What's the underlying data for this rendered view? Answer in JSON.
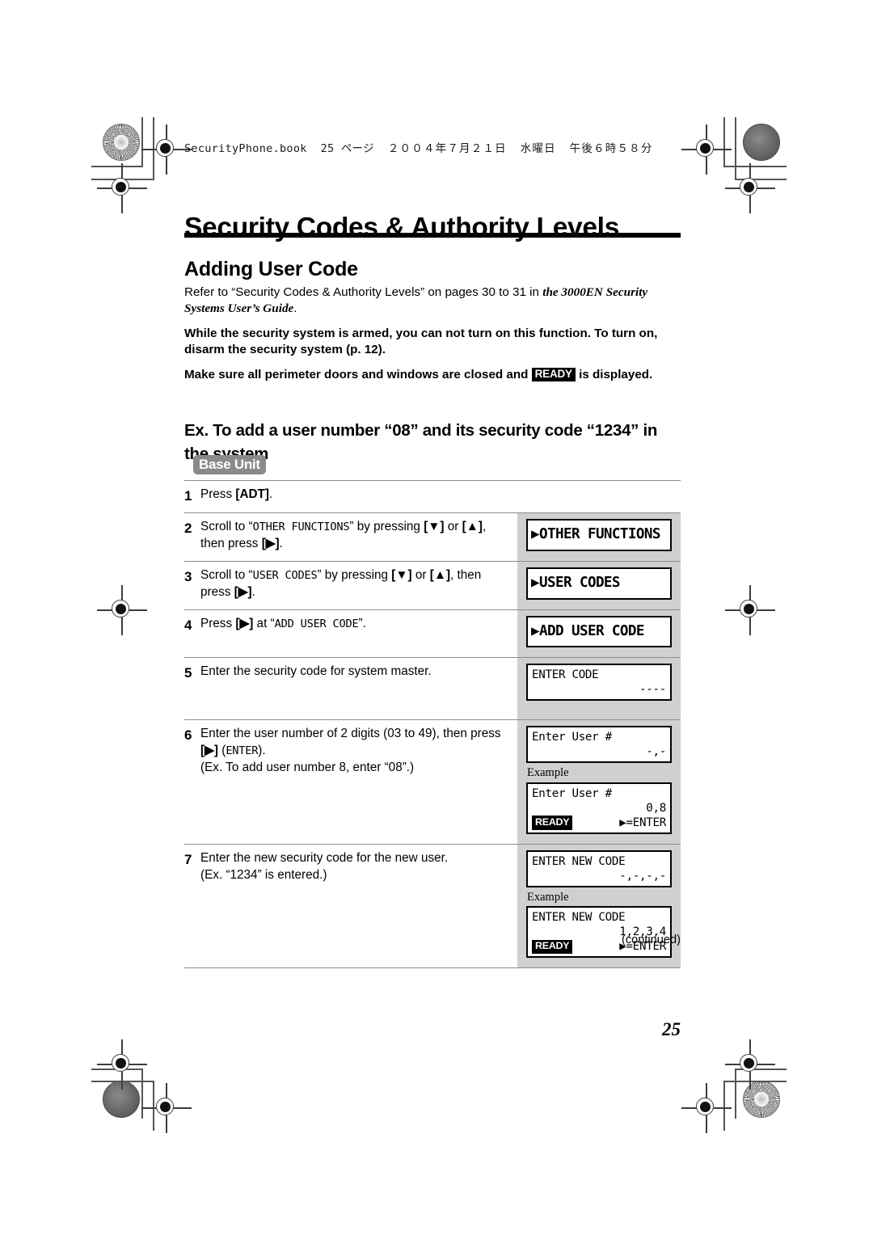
{
  "book_header": {
    "filename": "SecurityPhone.book",
    "page_label": "25 ページ",
    "date": "２００４年７月２１日",
    "weekday": "水曜日",
    "time": "午後６時５８分"
  },
  "page_title": "Security Codes & Authority Levels",
  "section_title": "Adding User Code",
  "paragraphs": {
    "refer_prefix": "Refer to “Security Codes & Authority Levels” on pages 30 to 31 in ",
    "refer_italic": "the 3000EN Security Systems User’s Guide",
    "refer_suffix": ".",
    "armed_note": "While the security system is armed, you can not turn on this function. To turn on, disarm the security system (p. 12).",
    "ready_prefix": "Make sure all perimeter doors and windows are closed and ",
    "ready_badge": "READY",
    "ready_suffix": " is displayed."
  },
  "example_heading": "Ex. To add a user number “08” and its security code “1234” in the system",
  "base_unit_badge": "Base Unit",
  "steps": [
    {
      "num": "1",
      "text_parts": [
        {
          "t": "Press ",
          "style": "plain"
        },
        {
          "t": "[ADT]",
          "style": "key"
        },
        {
          "t": ".",
          "style": "plain"
        }
      ],
      "panel": null
    },
    {
      "num": "2",
      "text_parts": [
        {
          "t": "Scroll to “",
          "style": "plain"
        },
        {
          "t": "OTHER FUNCTIONS",
          "style": "mono"
        },
        {
          "t": "” by pressing ",
          "style": "plain"
        },
        {
          "t": "[▼]",
          "style": "key"
        },
        {
          "t": " or ",
          "style": "plain"
        },
        {
          "t": "[▲]",
          "style": "key"
        },
        {
          "t": ", then press ",
          "style": "plain"
        },
        {
          "t": "[▶]",
          "style": "key"
        },
        {
          "t": ".",
          "style": "plain"
        }
      ],
      "panel": {
        "kind": "big",
        "lines": [
          "▶OTHER FUNCTIONS"
        ]
      }
    },
    {
      "num": "3",
      "text_parts": [
        {
          "t": "Scroll to “",
          "style": "plain"
        },
        {
          "t": "USER CODES",
          "style": "mono"
        },
        {
          "t": "” by pressing ",
          "style": "plain"
        },
        {
          "t": "[▼]",
          "style": "key"
        },
        {
          "t": " or ",
          "style": "plain"
        },
        {
          "t": "[▲]",
          "style": "key"
        },
        {
          "t": ", then press ",
          "style": "plain"
        },
        {
          "t": "[▶]",
          "style": "key"
        },
        {
          "t": ".",
          "style": "plain"
        }
      ],
      "panel": {
        "kind": "big",
        "lines": [
          "▶USER CODES"
        ]
      }
    },
    {
      "num": "4",
      "text_parts": [
        {
          "t": "Press ",
          "style": "plain"
        },
        {
          "t": "[▶]",
          "style": "key"
        },
        {
          "t": " at “",
          "style": "plain"
        },
        {
          "t": "ADD USER CODE",
          "style": "mono"
        },
        {
          "t": "”.",
          "style": "plain"
        }
      ],
      "panel": {
        "kind": "big",
        "lines": [
          "▶ADD USER CODE"
        ]
      }
    },
    {
      "num": "5",
      "text_parts": [
        {
          "t": "Enter the security code for system master.",
          "style": "plain"
        }
      ],
      "panel": {
        "kind": "small",
        "top": "ENTER CODE",
        "right": "----"
      }
    },
    {
      "num": "6",
      "text_parts": [
        {
          "t": "Enter the user number of 2 digits (03 to 49), then press ",
          "style": "plain"
        },
        {
          "t": "[▶]",
          "style": "key"
        },
        {
          "t": " (",
          "style": "plain"
        },
        {
          "t": "ENTER",
          "style": "mono"
        },
        {
          "t": ").",
          "style": "plain"
        },
        {
          "t": "\n(Ex. To add user number 8, enter “08”.)",
          "style": "plain"
        }
      ],
      "panel": {
        "kind": "small-example",
        "top": "Enter User #",
        "right": "-,-",
        "example_label": "Example",
        "ex_top": "Enter User #",
        "ex_right": "0,8",
        "ex_ready": "READY",
        "ex_enter": "▶=ENTER"
      }
    },
    {
      "num": "7",
      "text_parts": [
        {
          "t": "Enter the new security code for the new user.",
          "style": "plain"
        },
        {
          "t": "\n(Ex. “1234” is entered.)",
          "style": "plain"
        }
      ],
      "panel": {
        "kind": "small-example",
        "top": "ENTER NEW CODE",
        "right": "-,-,-,-",
        "example_label": "Example",
        "ex_top": "ENTER NEW CODE",
        "ex_right": "1,2,3,4",
        "ex_ready": "READY",
        "ex_enter": "▶=ENTER"
      }
    }
  ],
  "continued": "(continued)",
  "page_number": "25",
  "colors": {
    "panel_column_bg": "#d0d0d0",
    "base_unit_bg": "#8a8a8a",
    "rule": "#8c8c8c",
    "badge_bg": "#000000"
  }
}
